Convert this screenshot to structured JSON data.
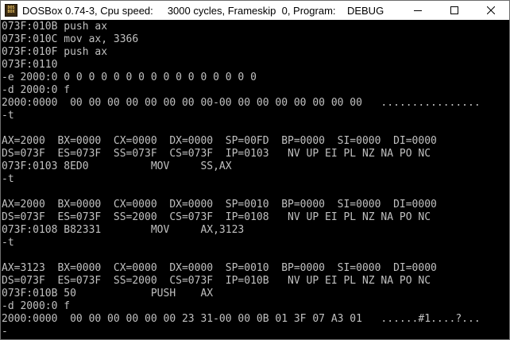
{
  "window": {
    "title": "DOSBox 0.74-3, Cpu speed:     3000 cycles, Frameskip  0, Program:    DEBUG",
    "icon_text_top": "DOS",
    "icon_text_bottom": "BOX"
  },
  "console": {
    "lines": [
      "073F:010B push ax",
      "073F:010C mov ax, 3366",
      "073F:010F push ax",
      "073F:0110",
      "-e 2000:0 0 0 0 0 0 0 0 0 0 0 0 0 0 0 0 0",
      "-d 2000:0 f",
      "2000:0000  00 00 00 00 00 00 00 00-00 00 00 00 00 00 00 00   ................",
      "-t",
      "",
      "AX=2000  BX=0000  CX=0000  DX=0000  SP=00FD  BP=0000  SI=0000  DI=0000",
      "DS=073F  ES=073F  SS=073F  CS=073F  IP=0103   NV UP EI PL NZ NA PO NC",
      "073F:0103 8ED0          MOV     SS,AX",
      "-t",
      "",
      "AX=2000  BX=0000  CX=0000  DX=0000  SP=0010  BP=0000  SI=0000  DI=0000",
      "DS=073F  ES=073F  SS=2000  CS=073F  IP=0108   NV UP EI PL NZ NA PO NC",
      "073F:0108 B82331        MOV     AX,3123",
      "-t",
      "",
      "AX=3123  BX=0000  CX=0000  DX=0000  SP=0010  BP=0000  SI=0000  DI=0000",
      "DS=073F  ES=073F  SS=2000  CS=073F  IP=010B   NV UP EI PL NZ NA PO NC",
      "073F:010B 50            PUSH    AX",
      "-d 2000:0 f",
      "2000:0000  00 00 00 00 00 00 23 31-00 00 0B 01 3F 07 A3 01   ......#1....?...",
      "-"
    ]
  },
  "colors": {
    "console_bg": "#000000",
    "console_text": "#c0c0c0",
    "titlebar_bg": "#ffffff"
  },
  "icons": {
    "minimize": "minimize-icon",
    "maximize": "maximize-icon",
    "close": "close-icon"
  }
}
